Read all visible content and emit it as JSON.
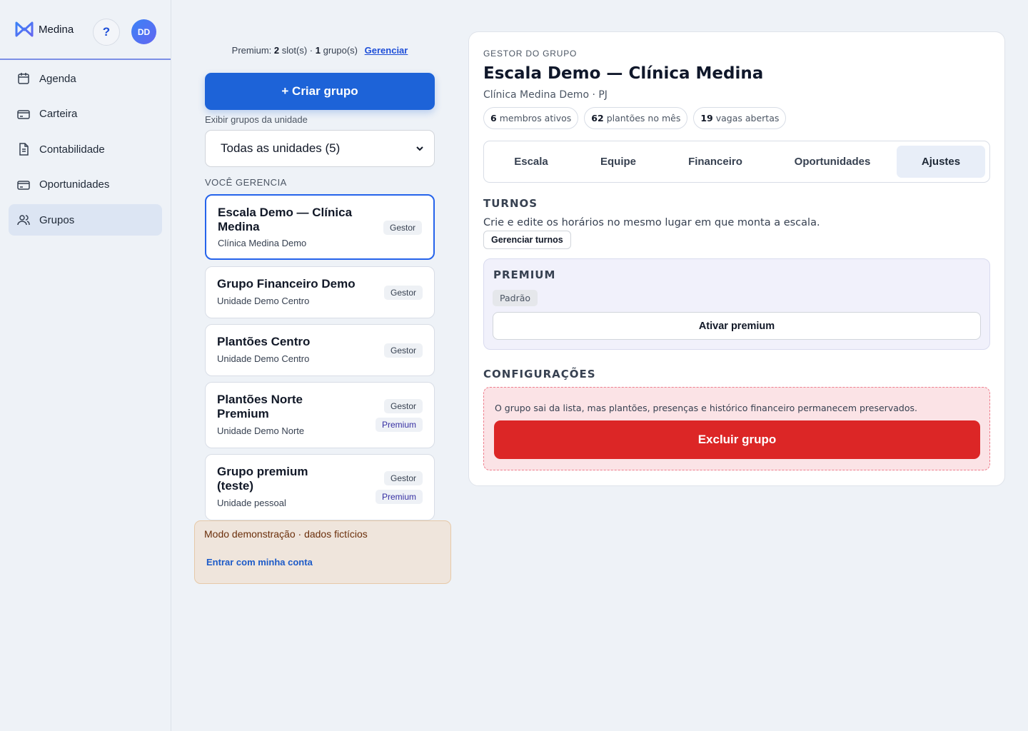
{
  "app": {
    "name": "Medina",
    "help": "?",
    "avatar_initials": "DD"
  },
  "nav": [
    {
      "label": "Agenda",
      "icon": "calendar-icon"
    },
    {
      "label": "Carteira",
      "icon": "wallet-icon"
    },
    {
      "label": "Contabilidade",
      "icon": "document-icon"
    },
    {
      "label": "Oportunidades",
      "icon": "card-icon"
    },
    {
      "label": "Grupos",
      "icon": "users-icon",
      "active": true
    }
  ],
  "premium_summary": {
    "prefix": "Premium:",
    "slots": "2",
    "slots_label": "slot(s) ·",
    "groups": "1",
    "groups_label": "grupo(s)",
    "manage_link": "Gerenciar"
  },
  "create_group": "+ Criar grupo",
  "unit_filter": {
    "label": "Exibir grupos da unidade",
    "selected": "Todas as unidades (5)"
  },
  "you_manage_label": "VOCÊ GERENCIA",
  "groups": [
    {
      "title": "Escala Demo — Clínica Medina",
      "subtitle": "Clínica Medina Demo",
      "tags": [
        "Gestor"
      ],
      "selected": true
    },
    {
      "title": "Grupo Financeiro Demo",
      "subtitle": "Unidade Demo Centro",
      "tags": [
        "Gestor"
      ]
    },
    {
      "title": "Plantões Centro",
      "subtitle": "Unidade Demo Centro",
      "tags": [
        "Gestor"
      ]
    },
    {
      "title": "Plantões Norte Premium",
      "subtitle": "Unidade Demo Norte",
      "tags": [
        "Gestor",
        "Premium"
      ]
    },
    {
      "title": "Grupo premium (teste)",
      "subtitle": "Unidade pessoal",
      "tags": [
        "Gestor",
        "Premium"
      ]
    }
  ],
  "demo_notice": {
    "text": "Modo demonstração · dados fictícios",
    "link": "Entrar com minha conta"
  },
  "detail": {
    "eyebrow": "GESTOR DO GRUPO",
    "title": "Escala Demo — Clínica Medina",
    "subtitle": "Clínica Medina Demo · PJ",
    "stats": [
      {
        "value": "6",
        "label": "membros ativos"
      },
      {
        "value": "62",
        "label": "plantões no mês"
      },
      {
        "value": "19",
        "label": "vagas abertas"
      }
    ],
    "tabs": [
      "Escala",
      "Equipe",
      "Financeiro",
      "Oportunidades",
      "Ajustes"
    ],
    "active_tab": "Ajustes",
    "turnos": {
      "heading": "TURNOS",
      "description": "Crie e edite os horários no mesmo lugar em que monta a escala.",
      "button": "Gerenciar turnos"
    },
    "premium": {
      "heading": "PREMIUM",
      "status": "Padrão",
      "button": "Ativar premium"
    },
    "config": {
      "heading": "CONFIGURAÇÕES",
      "warning": "O grupo sai da lista, mas plantões, presenças e histórico financeiro permanecem preservados.",
      "delete_button": "Excluir grupo"
    }
  },
  "colors": {
    "primary": "#1d63d8",
    "danger": "#dc2626",
    "accent": "#2563eb"
  }
}
